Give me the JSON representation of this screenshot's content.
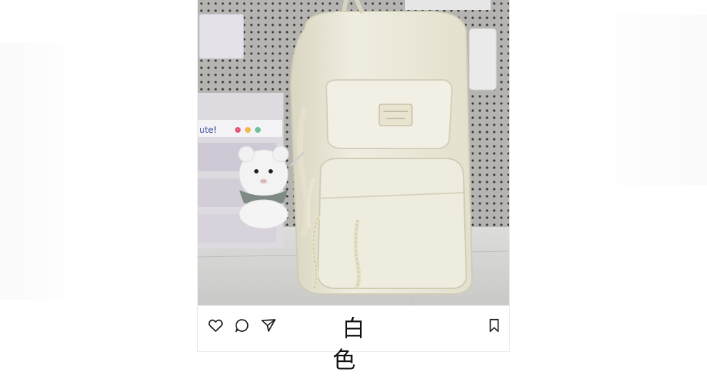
{
  "post": {
    "caption": "白 色",
    "badge_text": "",
    "actions": {
      "like_icon": "heart-icon",
      "comment_icon": "comment-icon",
      "share_icon": "send-icon",
      "save_icon": "bookmark-icon"
    }
  },
  "colors": {
    "backpack": "#ecead9",
    "pegboard": "#a9a8a4",
    "icon_stroke": "#222222",
    "caption_text": "#111111"
  }
}
